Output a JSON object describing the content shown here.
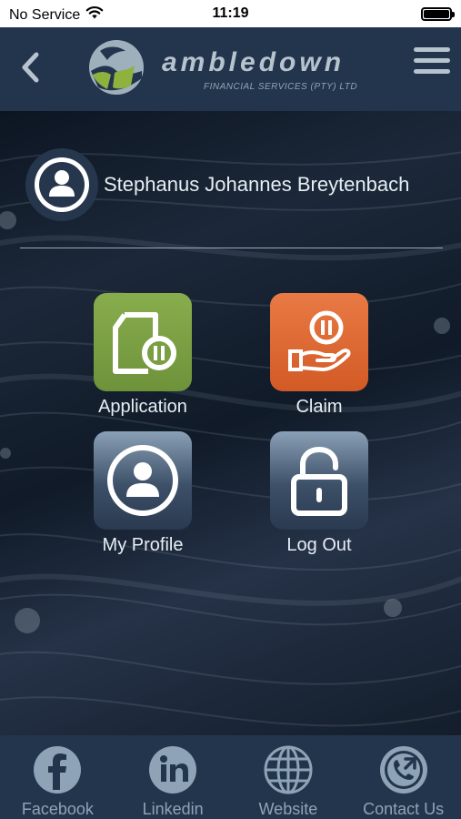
{
  "status_bar": {
    "carrier": "No Service",
    "time": "11:19"
  },
  "header": {
    "brand_name": "ambledown",
    "brand_subtitle": "FINANCIAL SERVICES (PTY) LTD"
  },
  "user": {
    "name": "Stephanus Johannes Breytenbach"
  },
  "tiles": [
    {
      "label": "Application",
      "icon": "document-pause-icon",
      "color": "#7a9f42"
    },
    {
      "label": "Claim",
      "icon": "hand-pause-icon",
      "color": "#e06a33"
    },
    {
      "label": "My Profile",
      "icon": "user-circle-icon",
      "color": "#3c5068"
    },
    {
      "label": "Log Out",
      "icon": "unlock-icon",
      "color": "#3c5068"
    }
  ],
  "footer": {
    "items": [
      {
        "label": "Facebook",
        "icon": "facebook-icon"
      },
      {
        "label": "Linkedin",
        "icon": "linkedin-icon"
      },
      {
        "label": "Website",
        "icon": "globe-icon"
      },
      {
        "label": "Contact Us",
        "icon": "phone-icon"
      }
    ]
  },
  "colors": {
    "header_bg": "#23354d",
    "accent_text": "#b7c3cd",
    "footer_label": "#8ea3b5"
  }
}
